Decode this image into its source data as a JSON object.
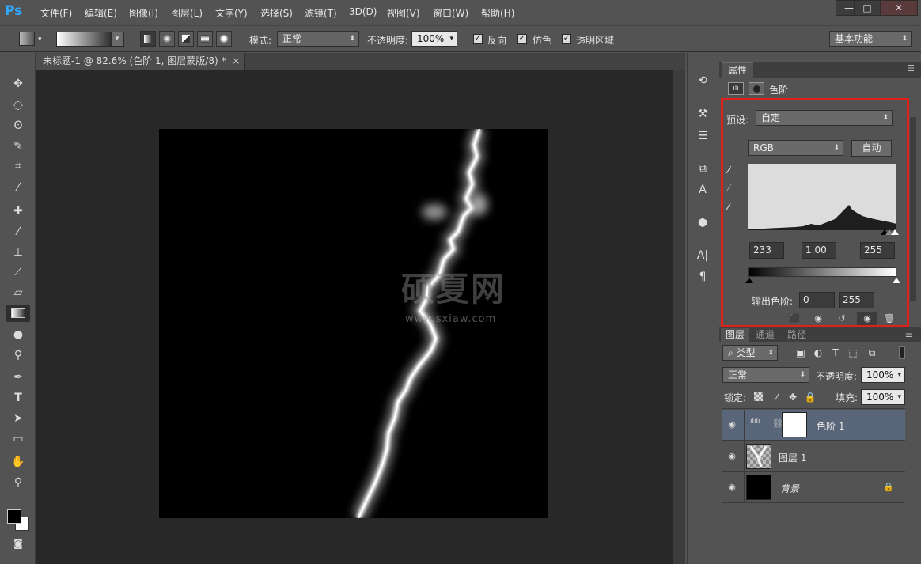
{
  "app": {
    "logo": "Ps",
    "menu": [
      "文件(F)",
      "编辑(E)",
      "图像(I)",
      "图层(L)",
      "文字(Y)",
      "选择(S)",
      "滤镜(T)",
      "3D(D)",
      "视图(V)",
      "窗口(W)",
      "帮助(H)"
    ],
    "window_controls": [
      "—",
      "□",
      "✕"
    ]
  },
  "options": {
    "mode_label": "模式:",
    "mode_value": "正常",
    "opacity_label": "不透明度:",
    "opacity_value": "100%",
    "reverse_label": "反向",
    "dither_label": "仿色",
    "transparency_label": "透明区域",
    "workspace": "基本功能"
  },
  "document": {
    "tab_title": "未标题-1 @ 82.6% (色阶 1, 图层蒙版/8) *",
    "close": "×",
    "watermark": "硕夏网",
    "watermark_url": "www.sxiaw.com"
  },
  "properties": {
    "tab": "属性",
    "title": "色阶",
    "preset_label": "预设:",
    "preset_value": "自定",
    "channel": "RGB",
    "auto_button": "自动",
    "input_black": "233",
    "input_gamma": "1.00",
    "input_white": "255",
    "output_label": "输出色阶:",
    "output_black": "0",
    "output_white": "255"
  },
  "layers": {
    "tabs": [
      "图层",
      "通道",
      "路径"
    ],
    "filter_label": "类型",
    "blend_mode": "正常",
    "opacity_label": "不透明度:",
    "opacity_value": "100%",
    "lock_label": "锁定:",
    "fill_label": "填充:",
    "fill_value": "100%",
    "items": [
      {
        "name": "色阶 1"
      },
      {
        "name": "图层 1"
      },
      {
        "name": "背景"
      }
    ]
  },
  "colors": {
    "accent_selection": "#596579",
    "highlight_box": "#e0201b",
    "ps_blue": "#31a8ff"
  }
}
